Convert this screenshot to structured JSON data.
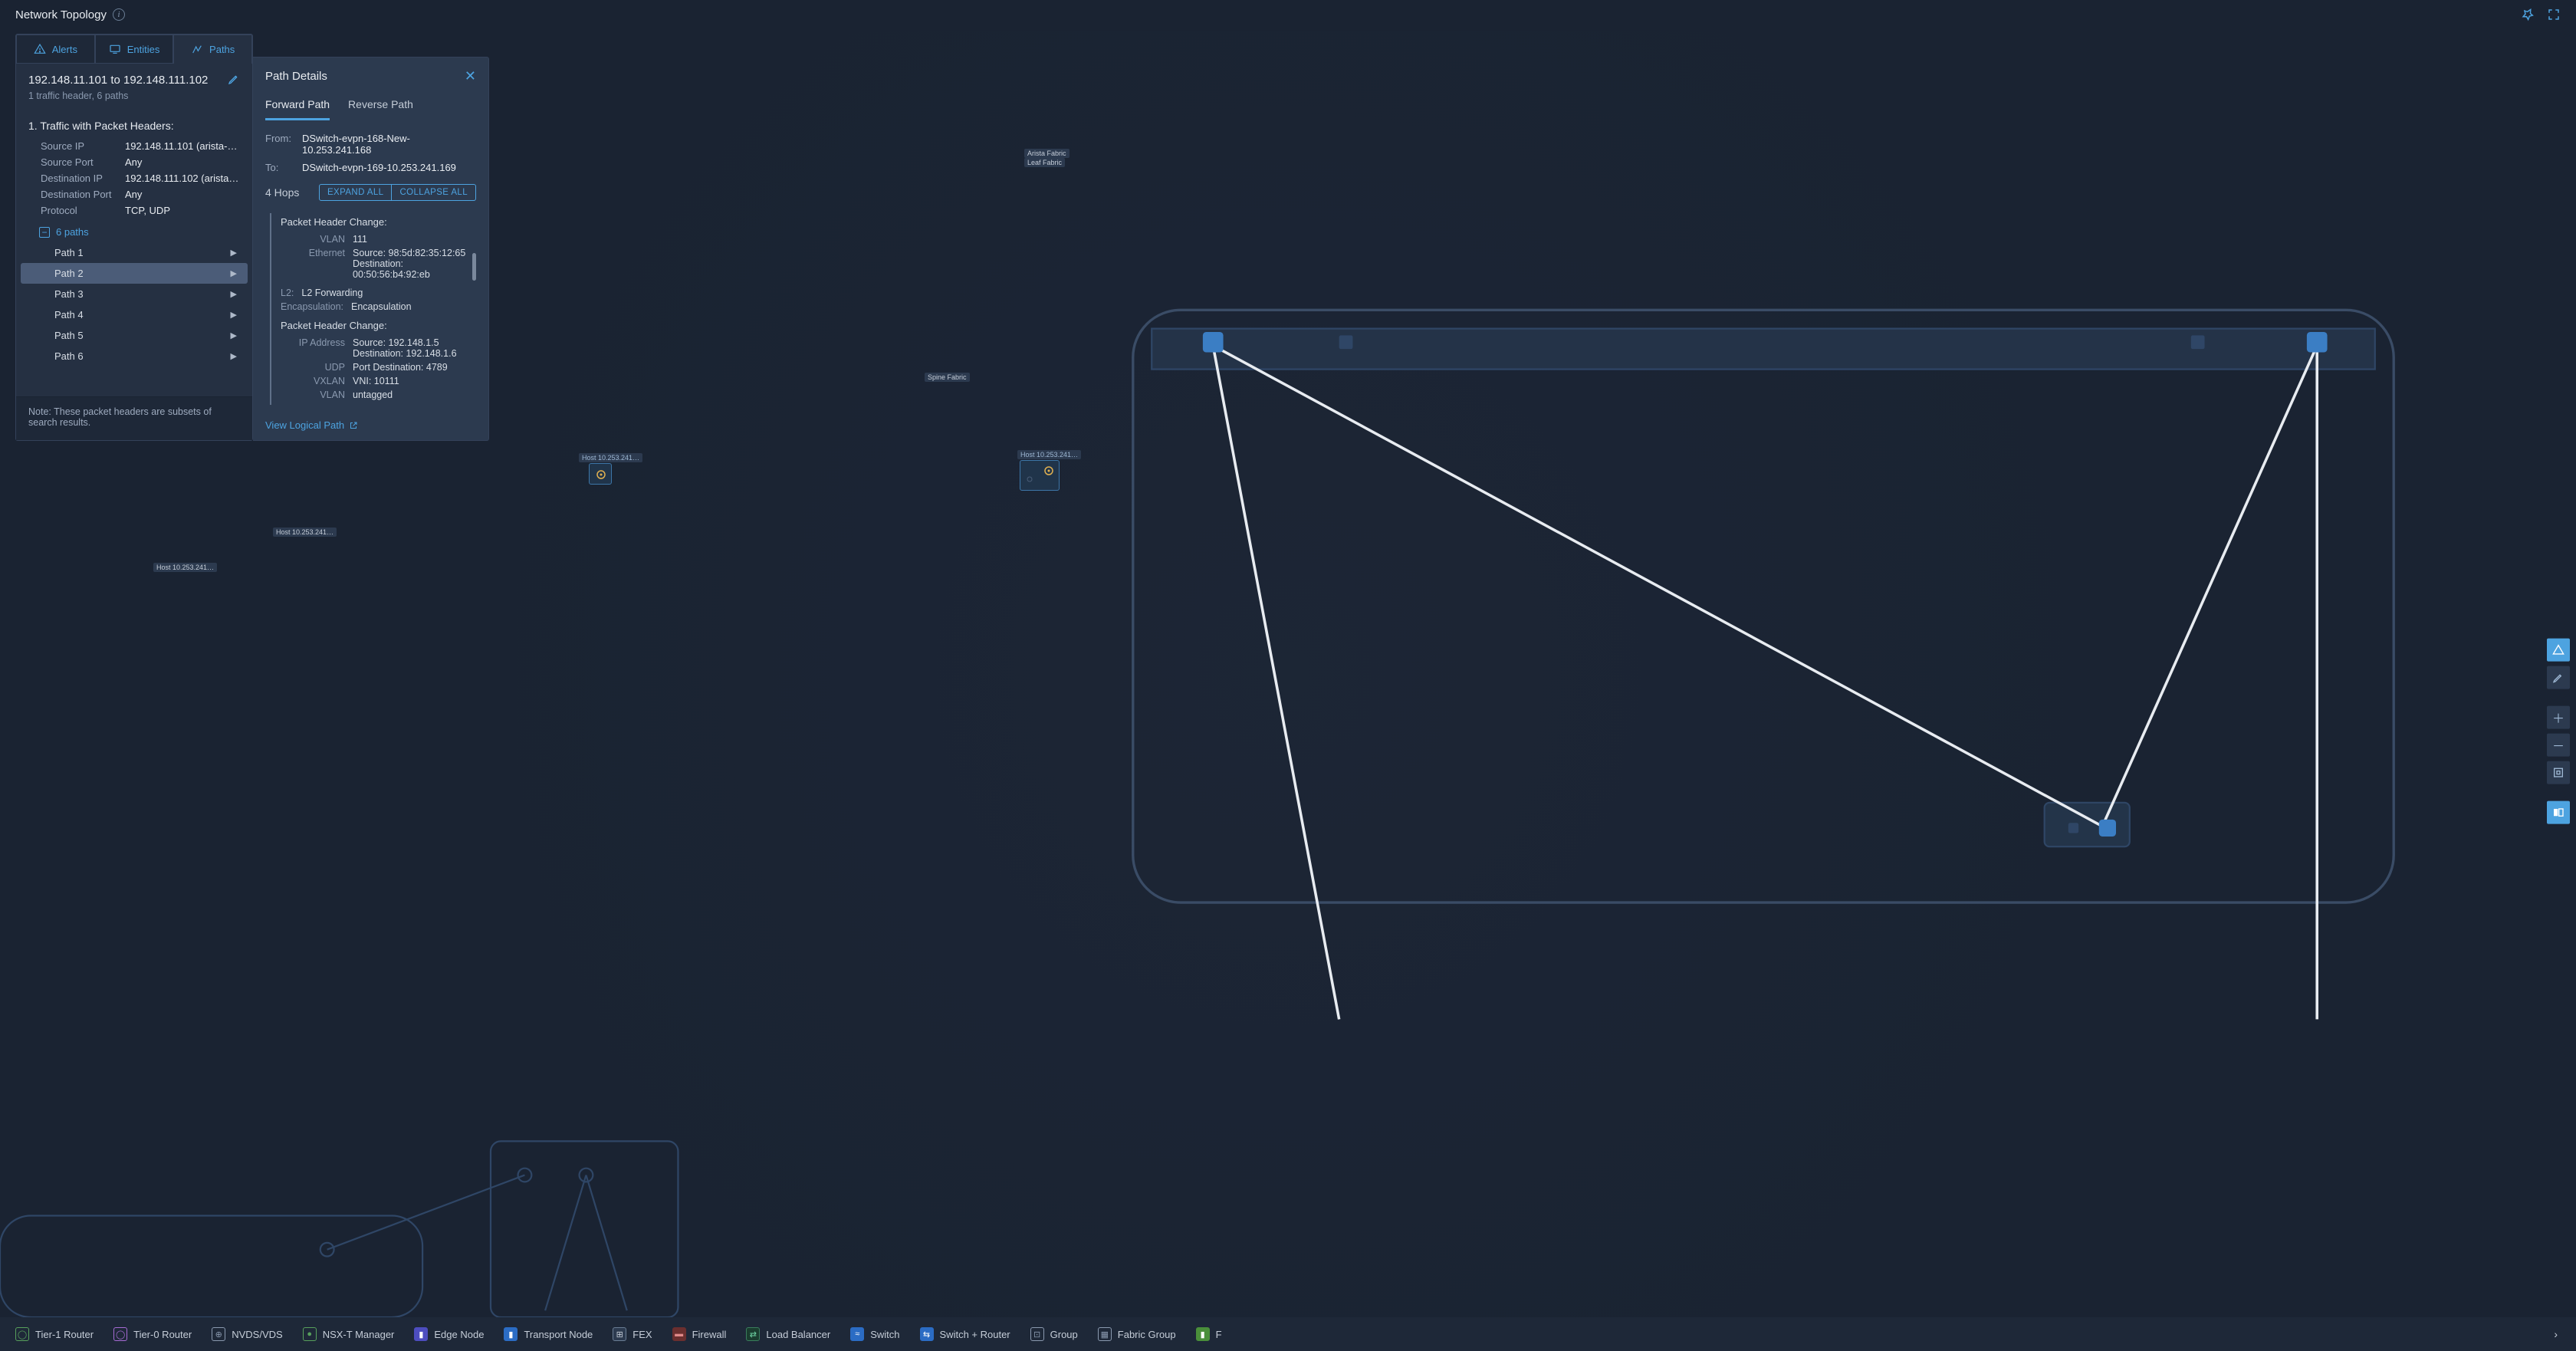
{
  "header": {
    "title": "Network Topology"
  },
  "tabs": {
    "alerts": "Alerts",
    "entities": "Entities",
    "paths": "Paths"
  },
  "query": {
    "title": "192.148.11.101 to 192.148.111.102",
    "subtitle": "1 traffic header, 6 paths"
  },
  "traffic": {
    "heading": "1. Traffic with Packet Headers:",
    "rows": {
      "src_ip_k": "Source IP",
      "src_ip_v": "192.148.11.101 (arista-vm1-…",
      "src_port_k": "Source Port",
      "src_port_v": "Any",
      "dst_ip_k": "Destination IP",
      "dst_ip_v": "192.148.111.102 (arista-vm…",
      "dst_port_k": "Destination Port",
      "dst_port_v": "Any",
      "proto_k": "Protocol",
      "proto_v": "TCP, UDP"
    },
    "paths_label": "6 paths",
    "paths": [
      "Path 1",
      "Path 2",
      "Path 3",
      "Path 4",
      "Path 5",
      "Path 6"
    ],
    "active_path_index": 1,
    "note": "Note: These packet headers are subsets of search results."
  },
  "path_details": {
    "title": "Path Details",
    "tab_forward": "Forward Path",
    "tab_reverse": "Reverse Path",
    "from_k": "From:",
    "from_v": "DSwitch-evpn-168-New-10.253.241.168",
    "to_k": "To:",
    "to_v": "DSwitch-evpn-169-10.253.241.169",
    "hops": "4 Hops",
    "expand": "EXPAND ALL",
    "collapse": "COLLAPSE ALL",
    "block1": {
      "title": "Packet Header Change:",
      "vlan_k": "VLAN",
      "vlan_v": "111",
      "eth_k": "Ethernet",
      "eth_src": "Source: 98:5d:82:35:12:65",
      "eth_dst": "Destination: 00:50:56:b4:92:eb",
      "l2_k": "L2:",
      "l2_v": "L2 Forwarding",
      "enc_k": "Encapsulation:",
      "enc_v": "Encapsulation"
    },
    "block2": {
      "title": "Packet Header Change:",
      "ip_k": "IP Address",
      "ip_src": "Source: 192.148.1.5",
      "ip_dst": "Destination: 192.148.1.6",
      "udp_k": "UDP",
      "udp_v": "Port Destination: 4789",
      "vx_k": "VXLAN",
      "vx_v": "VNI: 10111",
      "vlan_k": "VLAN",
      "vlan_v": "untagged"
    },
    "view_logical": "View Logical Path"
  },
  "topology": {
    "fabric_arista": "Arista Fabric",
    "fabric_leaf": "Leaf Fabric",
    "fabric_spine": "Spine Fabric",
    "host1": "Host 10.253.241…",
    "host2": "Host 10.253.241…",
    "host3": "Host 10.253.241…",
    "host4": "Host 10.253.241…"
  },
  "legend": {
    "items": [
      "Tier-1 Router",
      "Tier-0 Router",
      "NVDS/VDS",
      "NSX-T Manager",
      "Edge Node",
      "Transport Node",
      "FEX",
      "Firewall",
      "Load Balancer",
      "Switch",
      "Switch + Router",
      "Group",
      "Fabric Group",
      "F"
    ]
  }
}
